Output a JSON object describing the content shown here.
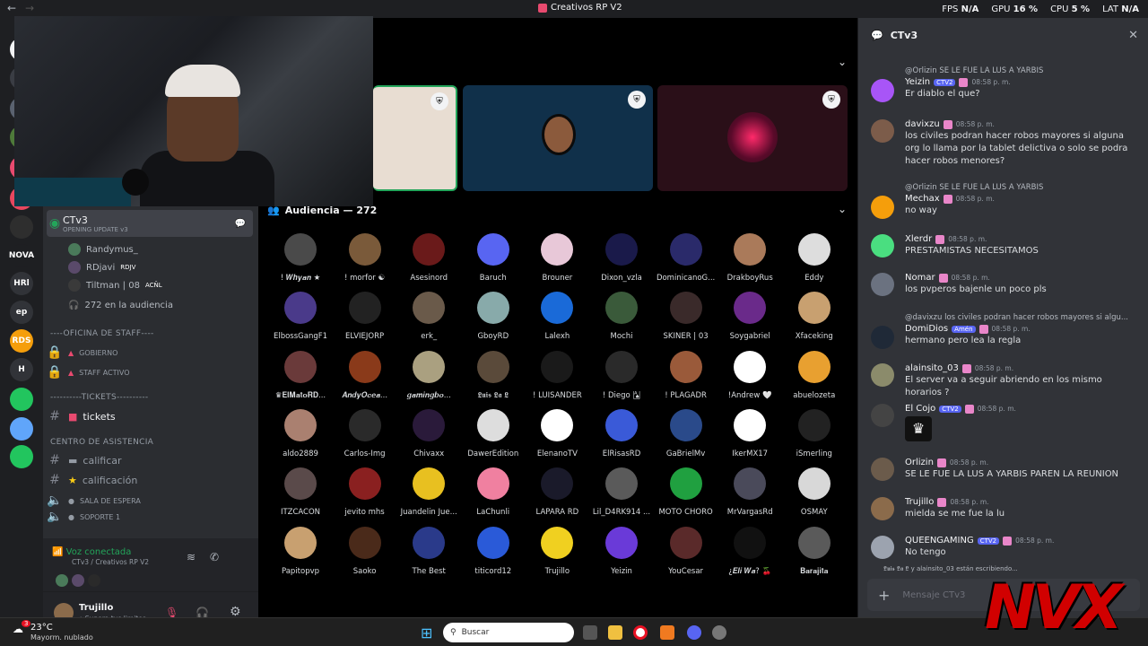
{
  "titlebar": {
    "title": "Creativos RP V2"
  },
  "perf": [
    {
      "label": "FPS",
      "value": "N/A"
    },
    {
      "label": "GPU",
      "value": "16 %"
    },
    {
      "label": "CPU",
      "value": "5 %"
    },
    {
      "label": "LAT",
      "value": "N/A"
    }
  ],
  "guilds": [
    {
      "label": "",
      "color": "#f2f3f5"
    },
    {
      "label": "",
      "color": "#3a3d44"
    },
    {
      "label": "",
      "color": "#5a6270"
    },
    {
      "label": "",
      "color": "#4e7a3a"
    },
    {
      "label": "",
      "color": "#e84a6f"
    },
    {
      "label": "",
      "color": "#e8475f"
    },
    {
      "label": "",
      "color": "#2e2e2e"
    },
    {
      "label": "NOVA",
      "color": "#1e1f22"
    },
    {
      "label": "HRl",
      "color": "#313338"
    },
    {
      "label": "ep",
      "color": "#313338"
    },
    {
      "label": "RDS",
      "color": "#f59e0b"
    },
    {
      "label": "H",
      "color": "#313338"
    },
    {
      "label": "",
      "color": "#22c55e"
    },
    {
      "label": "",
      "color": "#60a5fa"
    },
    {
      "label": "",
      "color": "#22c55e"
    }
  ],
  "sidebar": {
    "voice_channel": {
      "name": "CTv3",
      "subtitle": "OPENING UPDATE v3"
    },
    "voice_users": [
      "Randymus_",
      "RDjavi",
      "Tiltman | 08"
    ],
    "voice_user_tags": [
      "",
      "RDJV",
      "ACÑL"
    ],
    "audience_count": "272 en la audiencia",
    "cat1": "----OFICINA DE STAFF----",
    "staff_channels": [
      "GOBIERNO",
      "STAFF ACTIVO"
    ],
    "cat2": "----------TICKETS----------",
    "tickets": "tickets",
    "cat3": "CENTRO DE ASISTENCIA",
    "assist_channels": [
      "calificar",
      "calificación",
      "SALA DE ESPERA",
      "SOPORTE 1"
    ]
  },
  "voicebar": {
    "status": "Voz conectada",
    "channel": "CTv3 / Creativos RP V2"
  },
  "userbar": {
    "name": "Trujillo",
    "status": "• Supera tus limites"
  },
  "stage": {
    "audience_label": "Audiencia — 272"
  },
  "audience": [
    [
      "! 𝑾𝒉𝒚𝒂𝒏 ★",
      "! morfor ☯",
      "Asesinord",
      "Baruch",
      "Brouner",
      "Dixon_vzla",
      "DominicanoG...",
      "DrakboyRus",
      "Eddy"
    ],
    [
      "ElbossGangF1",
      "ELVIEJORP",
      "erk_",
      "GboyRD",
      "Lalexh",
      "Mochi",
      "SKINER | 03",
      "Soygabriel",
      "Xfaceking"
    ],
    [
      "♛𝐄𝐥𝐌𝐚𝐭𝐨𝐑𝐃...",
      "𝑨𝒏𝒅𝒚𝑶𝒄𝒆𝒂...",
      "𝒈𝒂𝒎𝒊𝒏𝒈𝒃𝒐...",
      "𝕷𝖚𝖎𝖘 𝕷𝖆 𝕷",
      "! LUISANDER",
      "! Diego 🂡",
      "! PLAGADR",
      "!Andrew 🤍",
      "abuelozeta"
    ],
    [
      "aldo2889",
      "Carlos-Img",
      "Chivaxx",
      "DawerEdition",
      "ElenanoTV",
      "ElRisasRD",
      "GaBrielMv",
      "IkerMX17",
      "iSmerling"
    ],
    [
      "ITZCACON",
      "jevito mhs",
      "Juandelin Jue...",
      "LaChunli",
      "LAPARA RD",
      "Lil_D4RK914 ...",
      "MOTO CHORO",
      "MrVargasRd",
      "OSMAY"
    ],
    [
      "Papitopvp",
      "Saoko",
      "The Best",
      "titicord12",
      "Trujillo",
      "Yeizin",
      "YouCesar",
      "¿𝑬𝒍𝒊 𝑾𝒂? 🍒",
      "𝐁𝐚𝐫𝐚𝐣𝐢𝐭𝐚"
    ]
  ],
  "chat": {
    "title": "CTv3",
    "input_placeholder": "Mensaje CTv3",
    "typing": "𝕷𝖚𝖎𝖘 𝕷𝖆 𝕷 y alainsito_03 están escribiendo...",
    "messages": [
      {
        "reply": "@Orlizin SE LE FUE LA LUS A YARBIS",
        "author": "Yeizin",
        "tag": "CTV2",
        "time": "08:58 p. m.",
        "text": "Er diablo el que?",
        "color": "#a855f7"
      },
      {
        "reply": "",
        "author": "davixzu",
        "tag": "",
        "time": "08:58 p. m.",
        "text": "los civiles podran hacer robos mayores si alguna org lo llama por la tablet delictiva o solo se podra hacer robos menores?",
        "color": "#7c5c4a"
      },
      {
        "reply": "@Orlizin SE LE FUE LA LUS A YARBIS",
        "author": "Mechax",
        "tag": "",
        "time": "08:58 p. m.",
        "text": "no way",
        "color": "#f59e0b"
      },
      {
        "reply": "",
        "author": "Xlerdr",
        "tag": "",
        "time": "08:58 p. m.",
        "text": "PRESTAMISTAS NECESITAMOS",
        "color": "#4ade80"
      },
      {
        "reply": "",
        "author": "Nomar",
        "tag": "",
        "time": "08:58 p. m.",
        "text": "los pvperos bajenle un poco pls",
        "color": "#6b7280"
      },
      {
        "reply": "@davixzu los civiles podran hacer robos mayores si algu...",
        "author": "DomiDios",
        "tag": "Amén",
        "time": "08:58 p. m.",
        "text": "hermano pero lea la regla",
        "color": "#1f2937"
      },
      {
        "reply": "",
        "author": "alainsito_03",
        "tag": "",
        "time": "08:58 p. m.",
        "text": "El server va a seguir abriendo en los mismo horarios ?",
        "color": "#8b8b6b"
      },
      {
        "reply": "",
        "author": "El Cojo",
        "tag": "CTV2",
        "time": "08:58 p. m.",
        "text": "",
        "color": "#444"
      },
      {
        "reply": "",
        "author": "Orlizin",
        "tag": "",
        "time": "08:58 p. m.",
        "text": "SE LE FUE LA LUS A YARBIS PAREN LA REUNION",
        "color": "#6b5b4b"
      },
      {
        "reply": "",
        "author": "Trujillo",
        "tag": "",
        "time": "08:58 p. m.",
        "text": "mielda se me fue la lu",
        "color": "#8b6b4b"
      },
      {
        "reply": "",
        "author": "QUEENGAMING",
        "tag": "CTV2",
        "time": "08:58 p. m.",
        "text": "No tengo",
        "color": "#9ca3af"
      }
    ]
  },
  "taskbar": {
    "weather_temp": "23°C",
    "weather_desc": "Mayorm. nublado",
    "search": "Buscar",
    "badge": "3"
  },
  "overlay": {
    "logo": "NVX"
  }
}
